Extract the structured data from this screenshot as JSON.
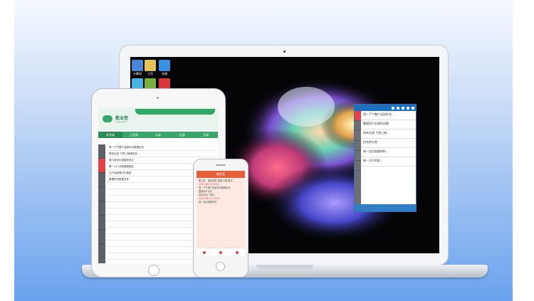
{
  "desktop": {
    "icons": [
      {
        "label": "计算机",
        "icon": "computer-icon",
        "color": "#4a86d8"
      },
      {
        "label": "工作",
        "icon": "folder-icon",
        "color": "#e3c258"
      },
      {
        "label": "关键",
        "icon": "x-app-icon",
        "color": "#3b8fe0"
      },
      {
        "label": "",
        "icon": "app-icon",
        "color": "#4ab3e6"
      },
      {
        "label": "",
        "icon": "recycle-icon",
        "color": "#7bb043"
      },
      {
        "label": "",
        "icon": "document-icon",
        "color": "#d9363e"
      }
    ]
  },
  "widget": {
    "items": [
      "周一下午整产品组件化...",
      "整理用户反馈的问题",
      "周末出游 下周三新...",
      "时光的计划",
      "周一会议准备材料...",
      "周一12:00前..."
    ],
    "colors": {
      "header": "#1f6fbf",
      "tab_active": "#e2424a"
    }
  },
  "tablet": {
    "app_name": "敬业签",
    "app_subtitle": "Jingyeqian",
    "nav": [
      "未完成",
      "已完成",
      "记录",
      "全部",
      "目录"
    ],
    "notes": [
      "周一下午整产品组件化整理出来",
      "周末出游 下周三新增任务...",
      "周六前优化某模块设计",
      "周一12:00前整理报告",
      "与产品经理讨论需求",
      "整理所有数据文件"
    ],
    "colors": {
      "brand": "#3aa56a"
    }
  },
  "phone": {
    "title": "敬业签",
    "lines": [
      "敬业签：团队便签·提醒·日程·备忘",
      "2019-08-01 09:00",
      "周一下午整产品组件化整理出来",
      "整理用户反馈",
      "周末出游 下周三",
      "2019-08-03 10:00",
      "周一会议准备材料"
    ],
    "colors": {
      "header": "#e5603a"
    }
  }
}
